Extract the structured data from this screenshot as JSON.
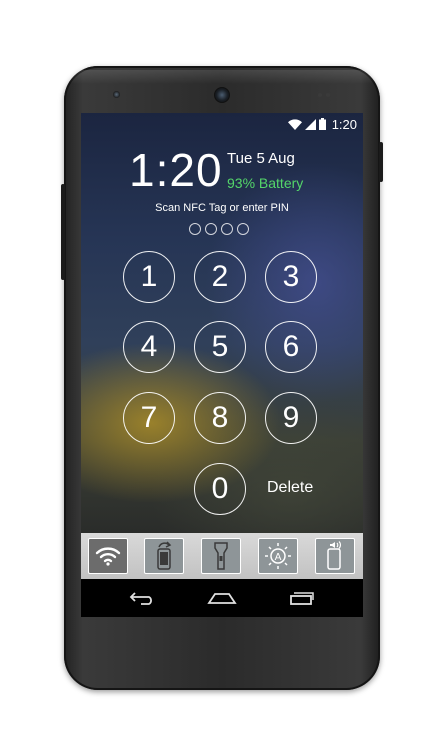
{
  "status_bar": {
    "time": "1:20"
  },
  "lockscreen": {
    "clock": "1:20",
    "date": "Tue 5 Aug",
    "battery_text": "93% Battery",
    "prompt": "Scan NFC Tag or enter PIN",
    "pin_length": 4
  },
  "keypad": {
    "keys": [
      "1",
      "2",
      "3",
      "4",
      "5",
      "6",
      "7",
      "8",
      "9",
      "0"
    ],
    "delete_label": "Delete"
  },
  "toolbar": {
    "items": [
      "wifi-icon",
      "rotate-icon",
      "flashlight-icon",
      "brightness-icon",
      "volume-icon"
    ],
    "active": "wifi-icon"
  },
  "colors": {
    "battery_text": "#54d66a",
    "toolbar_bg": "#c9c9c9",
    "active_tool": "#6c6c6c"
  }
}
